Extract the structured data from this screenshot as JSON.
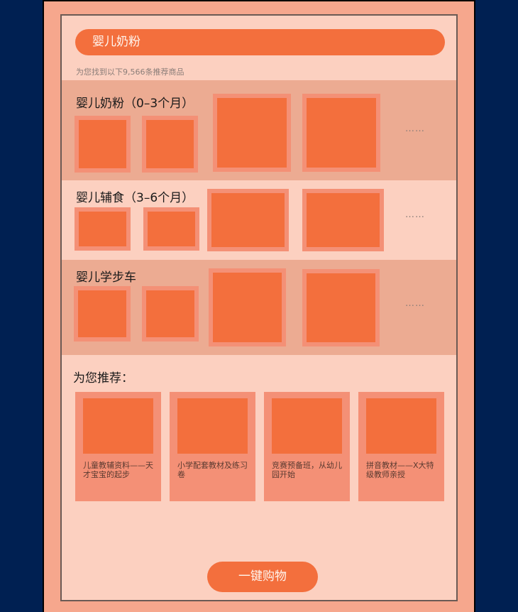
{
  "search": {
    "query": "婴儿奶粉"
  },
  "results": {
    "count_text": "为您找到以下9,566条推荐商品"
  },
  "categories": [
    {
      "title": "婴儿奶粉（0–3个月）",
      "more": "……"
    },
    {
      "title": "婴儿辅食（3–6个月）",
      "more": "……"
    },
    {
      "title": "婴儿学步车",
      "more": "……"
    }
  ],
  "recommend": {
    "title": "为您推荐：",
    "items": [
      {
        "text": "儿童教辅资料——天才宝宝的起步"
      },
      {
        "text": "小学配套教材及练习卷"
      },
      {
        "text": "竞赛预备班，从幼儿园开始"
      },
      {
        "text": "拼音教材——X大特级教师亲授"
      }
    ]
  },
  "actions": {
    "buy_all": "一键购物"
  }
}
